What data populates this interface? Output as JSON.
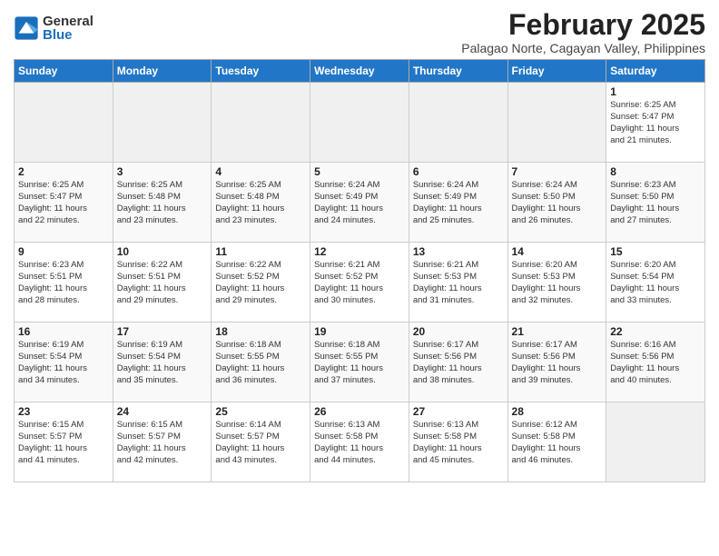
{
  "logo": {
    "general": "General",
    "blue": "Blue"
  },
  "title": "February 2025",
  "subtitle": "Palagao Norte, Cagayan Valley, Philippines",
  "weekdays": [
    "Sunday",
    "Monday",
    "Tuesday",
    "Wednesday",
    "Thursday",
    "Friday",
    "Saturday"
  ],
  "weeks": [
    [
      {
        "day": "",
        "info": ""
      },
      {
        "day": "",
        "info": ""
      },
      {
        "day": "",
        "info": ""
      },
      {
        "day": "",
        "info": ""
      },
      {
        "day": "",
        "info": ""
      },
      {
        "day": "",
        "info": ""
      },
      {
        "day": "1",
        "info": "Sunrise: 6:25 AM\nSunset: 5:47 PM\nDaylight: 11 hours\nand 21 minutes."
      }
    ],
    [
      {
        "day": "2",
        "info": "Sunrise: 6:25 AM\nSunset: 5:47 PM\nDaylight: 11 hours\nand 22 minutes."
      },
      {
        "day": "3",
        "info": "Sunrise: 6:25 AM\nSunset: 5:48 PM\nDaylight: 11 hours\nand 23 minutes."
      },
      {
        "day": "4",
        "info": "Sunrise: 6:25 AM\nSunset: 5:48 PM\nDaylight: 11 hours\nand 23 minutes."
      },
      {
        "day": "5",
        "info": "Sunrise: 6:24 AM\nSunset: 5:49 PM\nDaylight: 11 hours\nand 24 minutes."
      },
      {
        "day": "6",
        "info": "Sunrise: 6:24 AM\nSunset: 5:49 PM\nDaylight: 11 hours\nand 25 minutes."
      },
      {
        "day": "7",
        "info": "Sunrise: 6:24 AM\nSunset: 5:50 PM\nDaylight: 11 hours\nand 26 minutes."
      },
      {
        "day": "8",
        "info": "Sunrise: 6:23 AM\nSunset: 5:50 PM\nDaylight: 11 hours\nand 27 minutes."
      }
    ],
    [
      {
        "day": "9",
        "info": "Sunrise: 6:23 AM\nSunset: 5:51 PM\nDaylight: 11 hours\nand 28 minutes."
      },
      {
        "day": "10",
        "info": "Sunrise: 6:22 AM\nSunset: 5:51 PM\nDaylight: 11 hours\nand 29 minutes."
      },
      {
        "day": "11",
        "info": "Sunrise: 6:22 AM\nSunset: 5:52 PM\nDaylight: 11 hours\nand 29 minutes."
      },
      {
        "day": "12",
        "info": "Sunrise: 6:21 AM\nSunset: 5:52 PM\nDaylight: 11 hours\nand 30 minutes."
      },
      {
        "day": "13",
        "info": "Sunrise: 6:21 AM\nSunset: 5:53 PM\nDaylight: 11 hours\nand 31 minutes."
      },
      {
        "day": "14",
        "info": "Sunrise: 6:20 AM\nSunset: 5:53 PM\nDaylight: 11 hours\nand 32 minutes."
      },
      {
        "day": "15",
        "info": "Sunrise: 6:20 AM\nSunset: 5:54 PM\nDaylight: 11 hours\nand 33 minutes."
      }
    ],
    [
      {
        "day": "16",
        "info": "Sunrise: 6:19 AM\nSunset: 5:54 PM\nDaylight: 11 hours\nand 34 minutes."
      },
      {
        "day": "17",
        "info": "Sunrise: 6:19 AM\nSunset: 5:54 PM\nDaylight: 11 hours\nand 35 minutes."
      },
      {
        "day": "18",
        "info": "Sunrise: 6:18 AM\nSunset: 5:55 PM\nDaylight: 11 hours\nand 36 minutes."
      },
      {
        "day": "19",
        "info": "Sunrise: 6:18 AM\nSunset: 5:55 PM\nDaylight: 11 hours\nand 37 minutes."
      },
      {
        "day": "20",
        "info": "Sunrise: 6:17 AM\nSunset: 5:56 PM\nDaylight: 11 hours\nand 38 minutes."
      },
      {
        "day": "21",
        "info": "Sunrise: 6:17 AM\nSunset: 5:56 PM\nDaylight: 11 hours\nand 39 minutes."
      },
      {
        "day": "22",
        "info": "Sunrise: 6:16 AM\nSunset: 5:56 PM\nDaylight: 11 hours\nand 40 minutes."
      }
    ],
    [
      {
        "day": "23",
        "info": "Sunrise: 6:15 AM\nSunset: 5:57 PM\nDaylight: 11 hours\nand 41 minutes."
      },
      {
        "day": "24",
        "info": "Sunrise: 6:15 AM\nSunset: 5:57 PM\nDaylight: 11 hours\nand 42 minutes."
      },
      {
        "day": "25",
        "info": "Sunrise: 6:14 AM\nSunset: 5:57 PM\nDaylight: 11 hours\nand 43 minutes."
      },
      {
        "day": "26",
        "info": "Sunrise: 6:13 AM\nSunset: 5:58 PM\nDaylight: 11 hours\nand 44 minutes."
      },
      {
        "day": "27",
        "info": "Sunrise: 6:13 AM\nSunset: 5:58 PM\nDaylight: 11 hours\nand 45 minutes."
      },
      {
        "day": "28",
        "info": "Sunrise: 6:12 AM\nSunset: 5:58 PM\nDaylight: 11 hours\nand 46 minutes."
      },
      {
        "day": "",
        "info": ""
      }
    ]
  ]
}
